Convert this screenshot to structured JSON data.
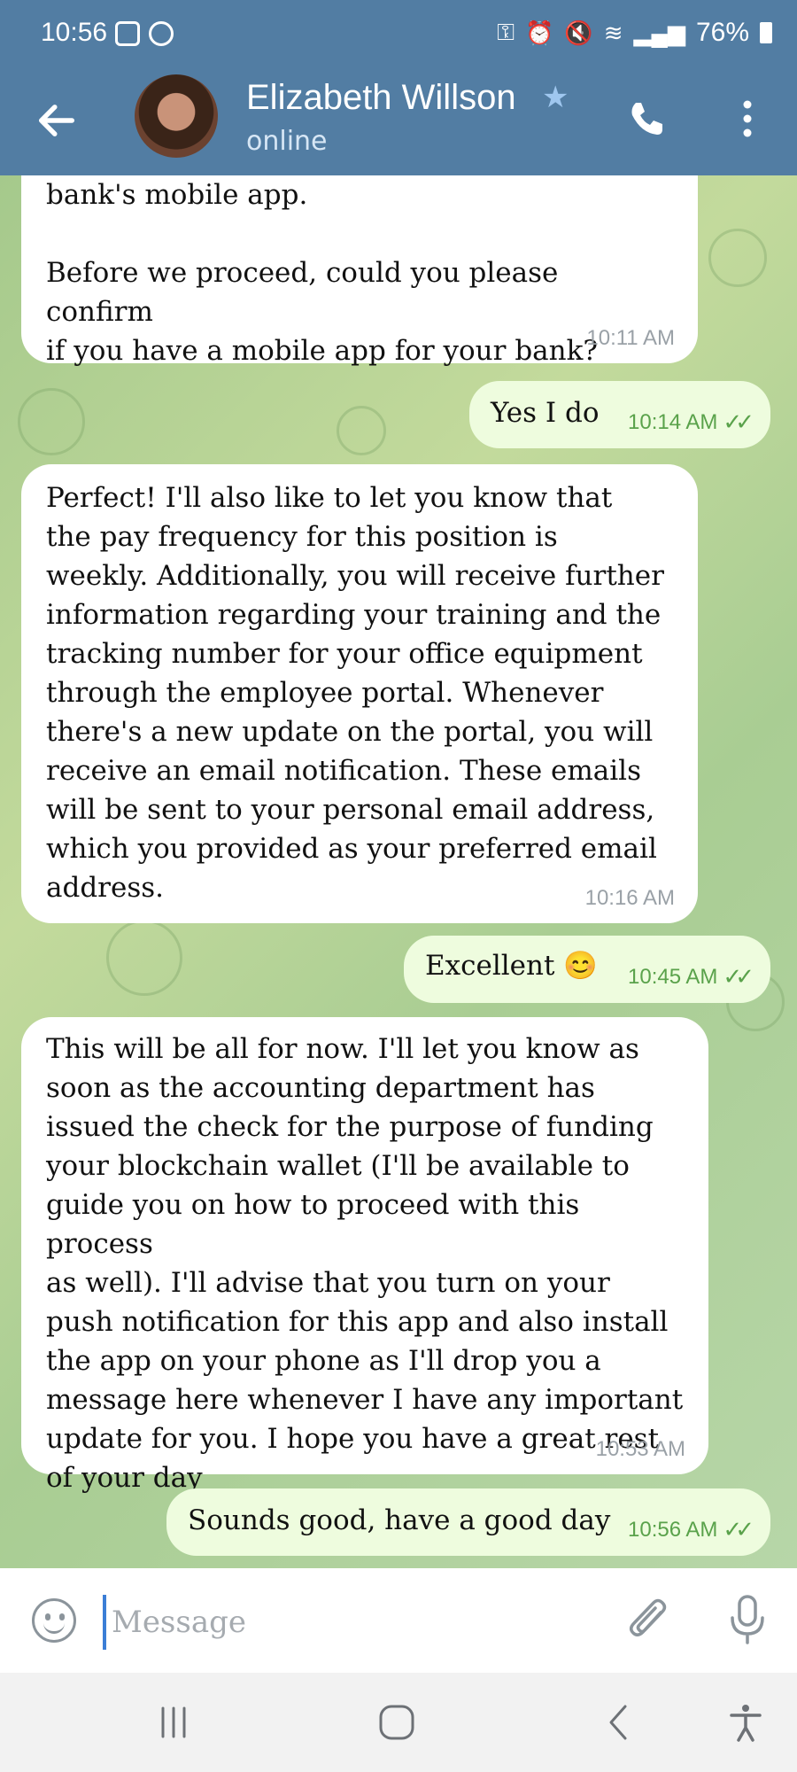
{
  "status_bar": {
    "time": "10:56",
    "battery": "76%"
  },
  "header": {
    "contact_name": "Elizabeth Willson",
    "status": "online"
  },
  "messages": [
    {
      "direction": "in",
      "text": "bank's mobile app.\n\nBefore we proceed, could you please confirm\nif you have a mobile app for your bank?",
      "time": "10:11 AM"
    },
    {
      "direction": "out",
      "text": "Yes I do",
      "time": "10:14 AM"
    },
    {
      "direction": "in",
      "text": "Perfect! I'll also like to let you know that\nthe pay frequency for this position is\nweekly. Additionally, you will receive further\ninformation regarding your training and the\ntracking number for your office equipment\nthrough the employee portal. Whenever\nthere's a new update on the portal, you will\nreceive an email notification. These emails\nwill be sent to your personal email address,\nwhich you provided as your preferred email\naddress.",
      "time": "10:16 AM"
    },
    {
      "direction": "out",
      "text": "Excellent 😊",
      "time": "10:45 AM"
    },
    {
      "direction": "in",
      "text": "This will be all for now. I'll let you know as\nsoon as the accounting department has\nissued the check for the purpose of funding\nyour blockchain wallet (I'll be available to\nguide you on how to proceed with this process\nas well). I'll advise that you turn on your\npush notification for this app and also install\nthe app on your phone as I'll drop you a\nmessage here whenever I have any important\nupdate for you. I hope you have a great rest\nof your day",
      "time": "10:53 AM"
    },
    {
      "direction": "out",
      "text": "Sounds good, have a good day",
      "time": "10:56 AM"
    }
  ],
  "input": {
    "placeholder": "Message",
    "value": ""
  },
  "colors": {
    "header": "#527da3",
    "outgoing_bubble": "#eefcde",
    "incoming_bubble": "#ffffff",
    "read_ticks": "#5aa24b"
  },
  "icons": [
    "back-arrow-icon",
    "star-icon",
    "phone-icon",
    "more-vert-icon",
    "emoji-icon",
    "attach-icon",
    "mic-icon",
    "recent-apps-icon",
    "home-icon",
    "nav-back-icon",
    "accessibility-icon"
  ]
}
